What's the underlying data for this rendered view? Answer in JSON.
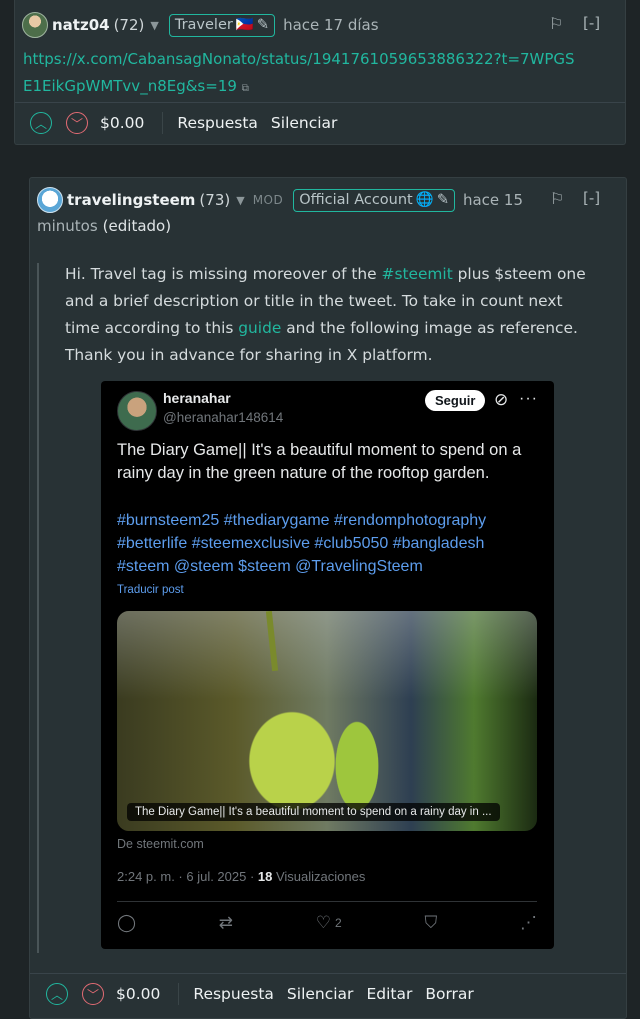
{
  "comment1": {
    "username": "natz04",
    "reputation": "(72)",
    "badge": "Traveler",
    "badge_flag": "🇵🇭",
    "time": "hace 17 días",
    "collapse": "[-]",
    "link_text": "https://x.com/CabansagNonato/status/1941761059653886322?t=7WPGSE1EikGpWMTvv_n8Eg&s=19",
    "payout": "$0.00",
    "actions": [
      "Respuesta",
      "Silenciar"
    ]
  },
  "comment2": {
    "username": "travelingsteem",
    "reputation": "(73)",
    "mod_label": "MOD",
    "badge": "Official Account",
    "badge_emoji": "🌐",
    "time_line1": "hace 15",
    "time_line2": "minutos",
    "edited": "(editado)",
    "collapse": "[-]",
    "body": {
      "p1": "Hi. Travel tag is missing moreover of the ",
      "link1": "#steemit",
      "p2": " plus $steem one and a brief description or title in the tweet. To take in count next time according to this ",
      "link2": "guide",
      "p3": " and the following image as reference. Thank you in advance for sharing in X platform."
    },
    "payout": "$0.00",
    "actions": [
      "Respuesta",
      "Silenciar",
      "Editar",
      "Borrar"
    ]
  },
  "tweet": {
    "name": "heranahar",
    "handle": "@heranahar148614",
    "follow": "Seguir",
    "text": "The Diary Game|| It's a beautiful moment to spend on a rainy day in the green nature of the rooftop garden.",
    "tags": "#burnsteem25 #thediarygame #rendomphotography #betterlife #steemexclusive #club5050 #bangladesh #steem @steem $steem @TravelingSteem",
    "translate": "Traducir post",
    "image_caption": "The Diary Game|| It's a beautiful moment to spend on a rainy day in ...",
    "source": "De steemit.com",
    "date": "2:24 p. m. · 6 jul. 2025 · ",
    "views_count": "18",
    "views_label": " Visualizaciones",
    "likes": "2"
  }
}
